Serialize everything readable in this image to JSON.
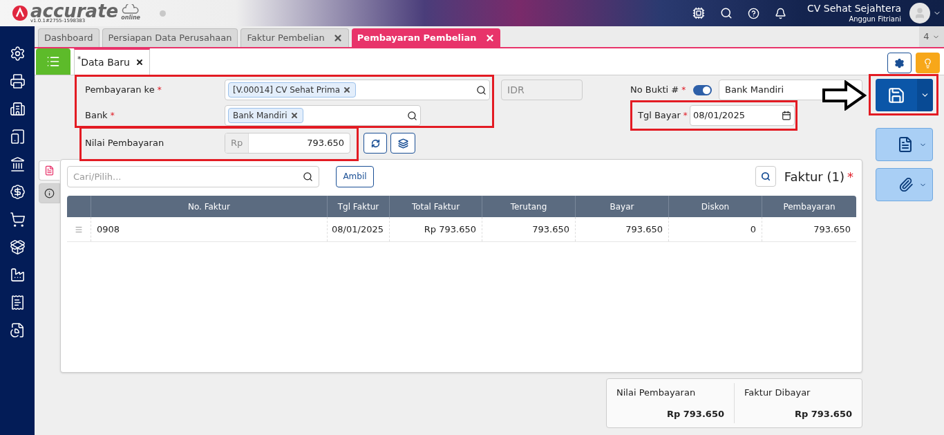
{
  "app": {
    "name": "accurate",
    "suffix": "online",
    "version": "v1.0.1#2755-1598383"
  },
  "user": {
    "company": "CV Sehat Sejahtera",
    "name": "Anggun Fitriani"
  },
  "tabs": [
    {
      "label": "Dashboard",
      "selected": false,
      "closable": false
    },
    {
      "label": "Persiapan Data Perusahaan",
      "selected": false,
      "closable": false
    },
    {
      "label": "Faktur Pembelian",
      "selected": false,
      "closable": true
    },
    {
      "label": "Pembayaran Pembelian",
      "selected": true,
      "closable": true
    }
  ],
  "tab_count": "4",
  "subtab": {
    "label": "Data Baru",
    "modified_mark": "*"
  },
  "form": {
    "pembayaran_ke": {
      "label": "Pembayaran ke",
      "required_mark": "*",
      "chip": "[V.00014] CV Sehat Prima"
    },
    "currency": "IDR",
    "no_bukti": {
      "label": "No Bukti #",
      "required_mark": "*",
      "auto": true,
      "value": "Bank Mandiri"
    },
    "bank": {
      "label": "Bank",
      "required_mark": "*",
      "chip": "Bank Mandiri"
    },
    "tgl_bayar": {
      "label": "Tgl Bayar",
      "required_mark": "*",
      "value": "08/01/2025"
    },
    "nilai": {
      "label": "Nilai Pembayaran",
      "prefix": "Rp",
      "value": "793.650"
    }
  },
  "panel": {
    "side_tabs": [
      {
        "kind": "document",
        "selected": true
      },
      {
        "kind": "info",
        "selected": false
      }
    ],
    "search": {
      "placeholder": "Cari/Pilih..."
    },
    "fetch_button": "Ambil",
    "title": "Faktur (1)",
    "required_mark": "*"
  },
  "table": {
    "columns": [
      "No. Faktur",
      "Tgl Faktur",
      "Total Faktur",
      "Terutang",
      "Bayar",
      "Diskon",
      "Pembayaran"
    ],
    "rows": [
      {
        "cells": [
          "0908",
          "08/01/2025",
          "Rp 793.650",
          "793.650",
          "793.650",
          "0",
          "793.650"
        ]
      }
    ]
  },
  "summary": [
    {
      "label": "Nilai Pembayaran",
      "value": "Rp 793.650"
    },
    {
      "label": "Faktur Dibayar",
      "value": "Rp 793.650"
    }
  ]
}
